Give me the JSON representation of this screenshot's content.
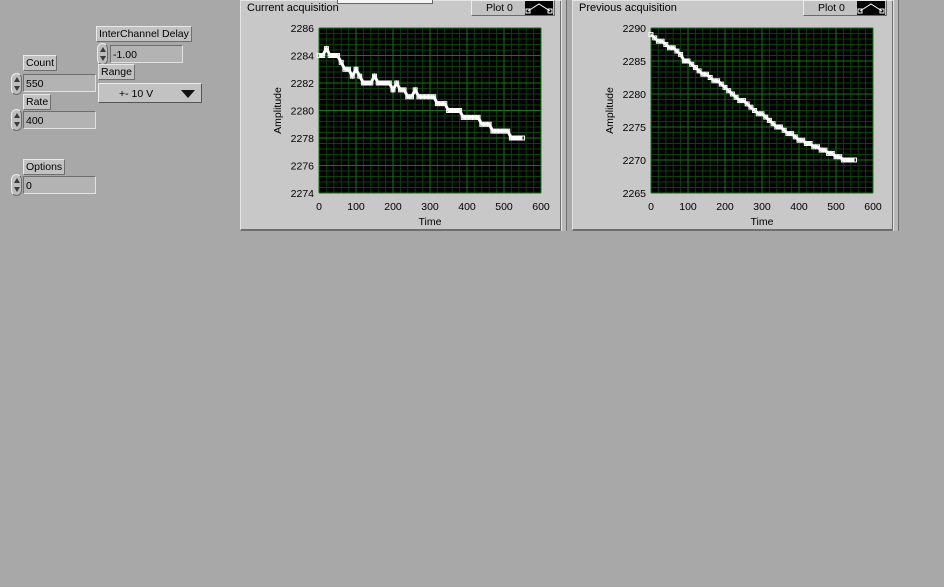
{
  "controls": {
    "count": {
      "label": "Count",
      "value": "550"
    },
    "rate": {
      "label": "Rate",
      "value": "400"
    },
    "options": {
      "label": "Options",
      "value": "0"
    },
    "interchannel_delay": {
      "label": "InterChannel Delay",
      "value": "-1.00"
    },
    "range": {
      "label": "Range",
      "value": "+- 10 V"
    }
  },
  "graphs": [
    {
      "title": "Current acquisition",
      "legend": "Plot 0",
      "xlabel": "Time",
      "ylabel": "Amplitude",
      "xticks": [
        "0",
        "100",
        "200",
        "300",
        "400",
        "500",
        "600"
      ],
      "yticks": [
        "2274",
        "2276",
        "2278",
        "2280",
        "2282",
        "2284",
        "2286"
      ]
    },
    {
      "title": "Previous acquisition",
      "legend": "Plot 0",
      "xlabel": "Time",
      "ylabel": "Amplitude",
      "xticks": [
        "0",
        "100",
        "200",
        "300",
        "400",
        "500",
        "600"
      ],
      "yticks": [
        "2265",
        "2270",
        "2275",
        "2280",
        "2285",
        "2290"
      ]
    }
  ],
  "colors": {
    "background": "#a8a8a8",
    "plot_area": "#000000",
    "grid": "#117a11",
    "trace": "#ffffff"
  },
  "chart_data": [
    {
      "type": "scatter",
      "title": "Current acquisition",
      "xlabel": "Time",
      "ylabel": "Amplitude",
      "xlim": [
        0,
        600
      ],
      "ylim": [
        2274,
        2286
      ],
      "grid": true,
      "series": [
        {
          "name": "Plot 0",
          "x": [
            0,
            10,
            20,
            30,
            40,
            50,
            60,
            70,
            80,
            90,
            100,
            110,
            120,
            130,
            140,
            150,
            160,
            170,
            180,
            190,
            200,
            210,
            220,
            230,
            240,
            250,
            260,
            270,
            280,
            290,
            300,
            310,
            320,
            330,
            340,
            350,
            360,
            370,
            380,
            390,
            400,
            410,
            420,
            430,
            440,
            450,
            460,
            470,
            480,
            490,
            500,
            510,
            520,
            530,
            540,
            550
          ],
          "y": [
            2284,
            2284,
            2284.5,
            2284,
            2284,
            2284,
            2283.5,
            2283,
            2283,
            2282.5,
            2283,
            2282.5,
            2282,
            2282,
            2282,
            2282.5,
            2282,
            2282,
            2282,
            2282,
            2281.5,
            2282,
            2281.5,
            2281.5,
            2281,
            2281,
            2281.5,
            2281,
            2281,
            2281,
            2281,
            2281,
            2280.5,
            2280.5,
            2280.5,
            2280,
            2280,
            2280,
            2280,
            2279.5,
            2279.5,
            2279.5,
            2279.5,
            2279.5,
            2279,
            2279,
            2279,
            2278.5,
            2278.5,
            2278.5,
            2278.5,
            2278.5,
            2278,
            2278,
            2278,
            2278
          ]
        }
      ]
    },
    {
      "type": "scatter",
      "title": "Previous acquisition",
      "xlabel": "Time",
      "ylabel": "Amplitude",
      "xlim": [
        0,
        600
      ],
      "ylim": [
        2265,
        2290
      ],
      "grid": true,
      "series": [
        {
          "name": "Plot 0",
          "x": [
            0,
            10,
            20,
            30,
            40,
            50,
            60,
            70,
            80,
            90,
            100,
            110,
            120,
            130,
            140,
            150,
            160,
            170,
            180,
            190,
            200,
            210,
            220,
            230,
            240,
            250,
            260,
            270,
            280,
            290,
            300,
            310,
            320,
            330,
            340,
            350,
            360,
            370,
            380,
            390,
            400,
            410,
            420,
            430,
            440,
            450,
            460,
            470,
            480,
            490,
            500,
            510,
            520,
            530,
            540,
            550
          ],
          "y": [
            2289,
            2288.5,
            2288,
            2288,
            2287.5,
            2287,
            2287,
            2286.5,
            2286,
            2285,
            2285,
            2284.5,
            2284,
            2283.5,
            2283,
            2283,
            2282.5,
            2282,
            2282,
            2281.5,
            2281,
            2280.5,
            2280,
            2279.5,
            2279,
            2279,
            2278.5,
            2278,
            2277.5,
            2277,
            2277,
            2276.5,
            2276,
            2275.5,
            2275,
            2275,
            2274.5,
            2274,
            2274,
            2273.5,
            2273,
            2273,
            2272.5,
            2272.5,
            2272,
            2272,
            2271.5,
            2271.5,
            2271,
            2271,
            2270.5,
            2270.5,
            2270,
            2270,
            2270,
            2270
          ]
        }
      ]
    }
  ]
}
